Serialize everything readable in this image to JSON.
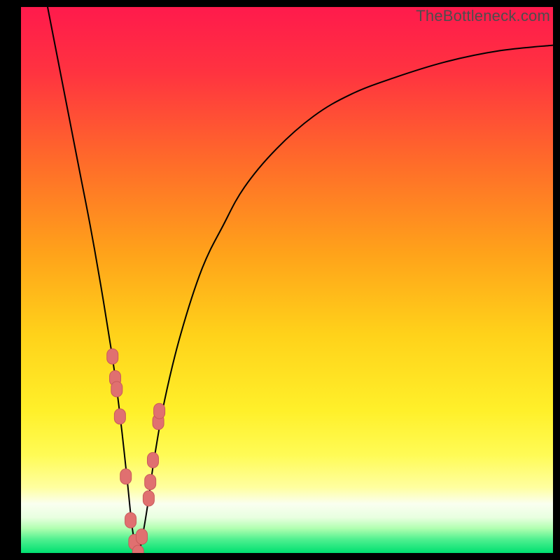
{
  "watermark": "TheBottleneck.com",
  "colors": {
    "frame": "#000000",
    "curve": "#000000",
    "marker_fill": "#e07070",
    "marker_stroke": "#c85a5a",
    "gradient_stops": [
      {
        "offset": 0.0,
        "color": "#ff1a4c"
      },
      {
        "offset": 0.12,
        "color": "#ff3340"
      },
      {
        "offset": 0.28,
        "color": "#ff6a2a"
      },
      {
        "offset": 0.45,
        "color": "#ffa21a"
      },
      {
        "offset": 0.6,
        "color": "#ffd21a"
      },
      {
        "offset": 0.74,
        "color": "#fff02a"
      },
      {
        "offset": 0.82,
        "color": "#fffb55"
      },
      {
        "offset": 0.88,
        "color": "#ffffa0"
      },
      {
        "offset": 0.91,
        "color": "#fafff0"
      },
      {
        "offset": 0.935,
        "color": "#e8ffe0"
      },
      {
        "offset": 0.955,
        "color": "#b0ffb0"
      },
      {
        "offset": 0.975,
        "color": "#50f090"
      },
      {
        "offset": 1.0,
        "color": "#00e070"
      }
    ]
  },
  "chart_data": {
    "type": "line",
    "title": "",
    "xlabel": "",
    "ylabel": "",
    "xlim": [
      0,
      100
    ],
    "ylim": [
      0,
      100
    ],
    "series": [
      {
        "name": "bottleneck-curve",
        "x": [
          5,
          7,
          9,
          11,
          13,
          15,
          17,
          18,
          19,
          20,
          21,
          22,
          23,
          24,
          25,
          27,
          30,
          34,
          38,
          42,
          48,
          55,
          62,
          70,
          80,
          90,
          100
        ],
        "y": [
          100,
          90,
          80,
          70,
          60,
          49,
          37,
          30,
          22,
          13,
          4,
          0,
          4,
          10,
          17,
          28,
          40,
          52,
          60,
          67,
          74,
          80,
          84,
          87,
          90,
          92,
          93
        ]
      }
    ],
    "markers": {
      "name": "highlight-points",
      "x": [
        17.2,
        17.7,
        18.0,
        18.6,
        19.7,
        20.6,
        21.3,
        22.0,
        22.7,
        24.0,
        24.3,
        24.8,
        25.8,
        26.0
      ],
      "y": [
        36,
        32,
        30,
        25,
        14,
        6,
        2,
        0,
        3,
        10,
        13,
        17,
        24,
        26
      ]
    }
  }
}
